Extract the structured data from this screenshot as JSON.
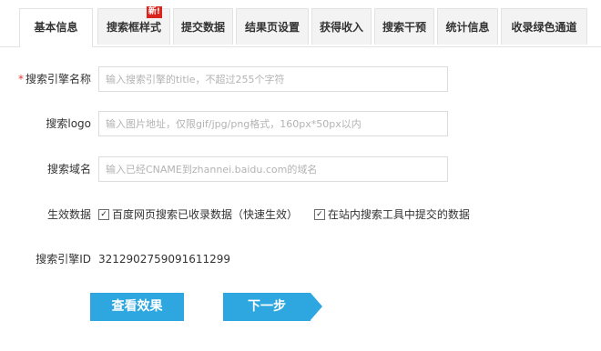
{
  "tabs": [
    {
      "label": "基本信息",
      "active": true
    },
    {
      "label": "搜索框样式",
      "badge": "新!"
    },
    {
      "label": "提交数据"
    },
    {
      "label": "结果页设置"
    },
    {
      "label": "获得收入"
    },
    {
      "label": "搜索干预"
    },
    {
      "label": "统计信息"
    },
    {
      "label": "收录绿色通道"
    }
  ],
  "form": {
    "name": {
      "required_mark": "*",
      "label": "搜索引擎名称",
      "value": "",
      "placeholder": "输入搜索引擎的title，不超过255个字符"
    },
    "logo": {
      "label": "搜索logo",
      "value": "",
      "placeholder": "输入图片地址，仅限gif/jpg/png格式，160px*50px以内"
    },
    "domain": {
      "label": "搜索域名",
      "value": "",
      "placeholder": "输入已经CNAME到zhannei.baidu.com的域名"
    },
    "effective": {
      "label": "生效数据",
      "options": [
        {
          "label": "百度网页搜索已收录数据（快速生效）",
          "checked": true
        },
        {
          "label": "在站内搜索工具中提交的数据",
          "checked": true
        }
      ]
    },
    "engine_id": {
      "label": "搜索引擎ID",
      "value": "3212902759091611299"
    }
  },
  "buttons": {
    "preview": "查看效果",
    "next": "下一步"
  },
  "colors": {
    "accent": "#2ea7e0",
    "required": "#e4393c",
    "badge": "#d9251d"
  }
}
